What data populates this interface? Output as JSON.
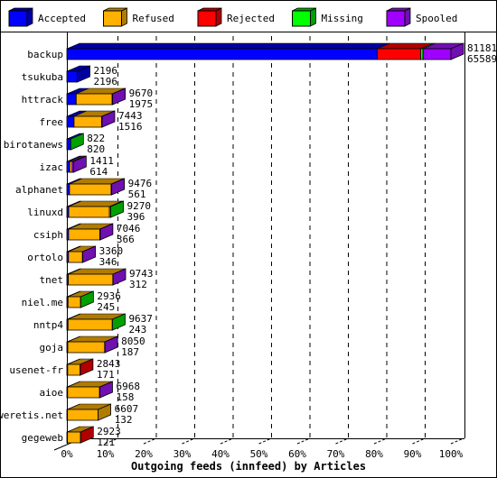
{
  "chart_data": {
    "type": "bar",
    "orientation": "horizontal",
    "stacked": true,
    "style": "3d",
    "title": "",
    "xlabel": "Outgoing feeds (innfeed) by Articles",
    "ylabel": "",
    "xlim": [
      0,
      100
    ],
    "x_ticks": [
      "0%",
      "10%",
      "20%",
      "30%",
      "40%",
      "50%",
      "60%",
      "70%",
      "80%",
      "90%",
      "100%"
    ],
    "grid": true,
    "legend_position": "top",
    "series": [
      {
        "name": "Accepted",
        "color": "#0000ff",
        "dark": "#0000a0"
      },
      {
        "name": "Refused",
        "color": "#ffb000",
        "dark": "#b07c00"
      },
      {
        "name": "Rejected",
        "color": "#ff0000",
        "dark": "#b00000"
      },
      {
        "name": "Missing",
        "color": "#00ff00",
        "dark": "#00a000"
      },
      {
        "name": "Spooled",
        "color": "#a000ff",
        "dark": "#7010b0"
      }
    ],
    "categories": [
      "backup",
      "tsukuba",
      "httrack",
      "free",
      "birotanews",
      "izac",
      "alphanet",
      "linuxd",
      "csiph",
      "ortolo",
      "tnet",
      "niel.me",
      "nntp4",
      "goja",
      "usenet-fr",
      "aioe",
      "weretis.net",
      "gegeweb"
    ],
    "totals": [
      "81181",
      "2196",
      "9670",
      "7443",
      "822",
      "1411",
      "9476",
      "9270",
      "7046",
      "3360",
      "9743",
      "2936",
      "9637",
      "8050",
      "2843",
      "6968",
      "6607",
      "2923"
    ],
    "accepted": [
      "65589",
      "2196",
      "1975",
      "1516",
      "820",
      "614",
      "561",
      "396",
      "366",
      "346",
      "312",
      "245",
      "243",
      "187",
      "171",
      "158",
      "132",
      "121"
    ],
    "components": [
      [
        65589,
        0,
        9200,
        500,
        5892
      ],
      [
        2196,
        0,
        0,
        0,
        0
      ],
      [
        1975,
        7600,
        0,
        0,
        95
      ],
      [
        1516,
        5850,
        40,
        0,
        37
      ],
      [
        820,
        0,
        0,
        2,
        0
      ],
      [
        614,
        500,
        0,
        0,
        297
      ],
      [
        561,
        8800,
        0,
        0,
        115
      ],
      [
        396,
        8600,
        0,
        274,
        0
      ],
      [
        366,
        6600,
        0,
        0,
        80
      ],
      [
        346,
        2950,
        0,
        0,
        64
      ],
      [
        312,
        9400,
        0,
        0,
        31
      ],
      [
        245,
        2650,
        0,
        41,
        0
      ],
      [
        243,
        9350,
        0,
        44,
        0
      ],
      [
        187,
        7800,
        0,
        0,
        63
      ],
      [
        171,
        2630,
        42,
        0,
        0
      ],
      [
        158,
        6750,
        0,
        0,
        60
      ],
      [
        132,
        6475,
        0,
        0,
        0
      ],
      [
        121,
        2760,
        42,
        0,
        0
      ]
    ]
  }
}
